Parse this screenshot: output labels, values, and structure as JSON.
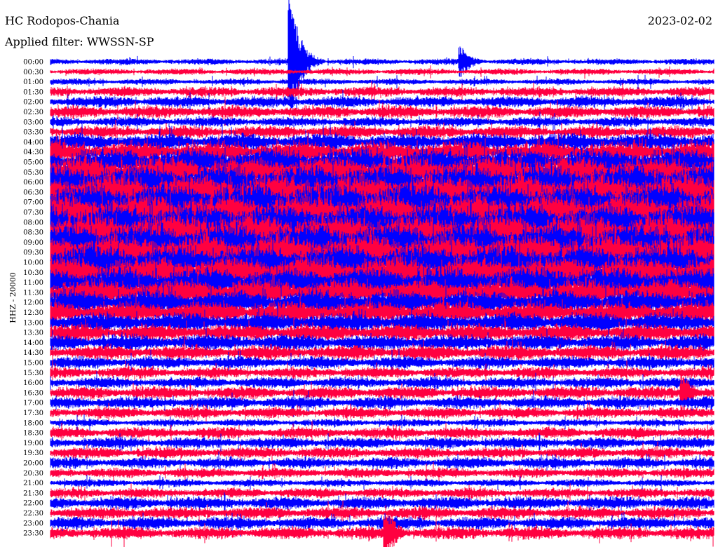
{
  "header": {
    "station": "HC Rodopos-Chania",
    "filter": "Applied filter: WWSSN-SP",
    "date": "2023-02-02"
  },
  "chart_data": {
    "type": "line",
    "title": "HC Rodopos-Chania",
    "ylabel": "HHZ - 20000",
    "xlabel": "",
    "x_range_minutes_per_row": [
      0,
      30
    ],
    "row_labels": [
      "00:00",
      "00:30",
      "01:00",
      "01:30",
      "02:00",
      "02:30",
      "03:00",
      "03:30",
      "04:00",
      "04:30",
      "05:00",
      "05:30",
      "06:00",
      "06:30",
      "07:00",
      "07:30",
      "08:00",
      "08:30",
      "09:00",
      "09:30",
      "10:00",
      "10:30",
      "11:00",
      "11:30",
      "12:00",
      "12:30",
      "13:00",
      "13:30",
      "14:00",
      "14:30",
      "15:00",
      "15:30",
      "16:00",
      "16:30",
      "17:00",
      "17:30",
      "18:00",
      "18:30",
      "19:00",
      "19:30",
      "20:00",
      "20:30",
      "21:00",
      "21:30",
      "22:00",
      "22:30",
      "23:00",
      "23:30"
    ],
    "series_colors": [
      "#0000ff",
      "#ff0040"
    ],
    "relative_amplitude": [
      5,
      5,
      5,
      8,
      9,
      10,
      8,
      10,
      14,
      18,
      22,
      26,
      28,
      30,
      30,
      30,
      30,
      30,
      30,
      30,
      28,
      26,
      24,
      22,
      20,
      18,
      16,
      14,
      13,
      12,
      10,
      9,
      9,
      10,
      10,
      9,
      6,
      9,
      9,
      9,
      9,
      8,
      6,
      8,
      10,
      10,
      10,
      10
    ],
    "events": [
      {
        "row": "00:00",
        "minute": 10.9,
        "relative_amplitude": 90
      },
      {
        "row": "00:00",
        "minute": 18.6,
        "relative_amplitude": 22
      },
      {
        "row": "16:30",
        "minute": 28.6,
        "relative_amplitude": 30
      },
      {
        "row": "23:30",
        "minute": 15.2,
        "relative_amplitude": 40
      }
    ]
  }
}
